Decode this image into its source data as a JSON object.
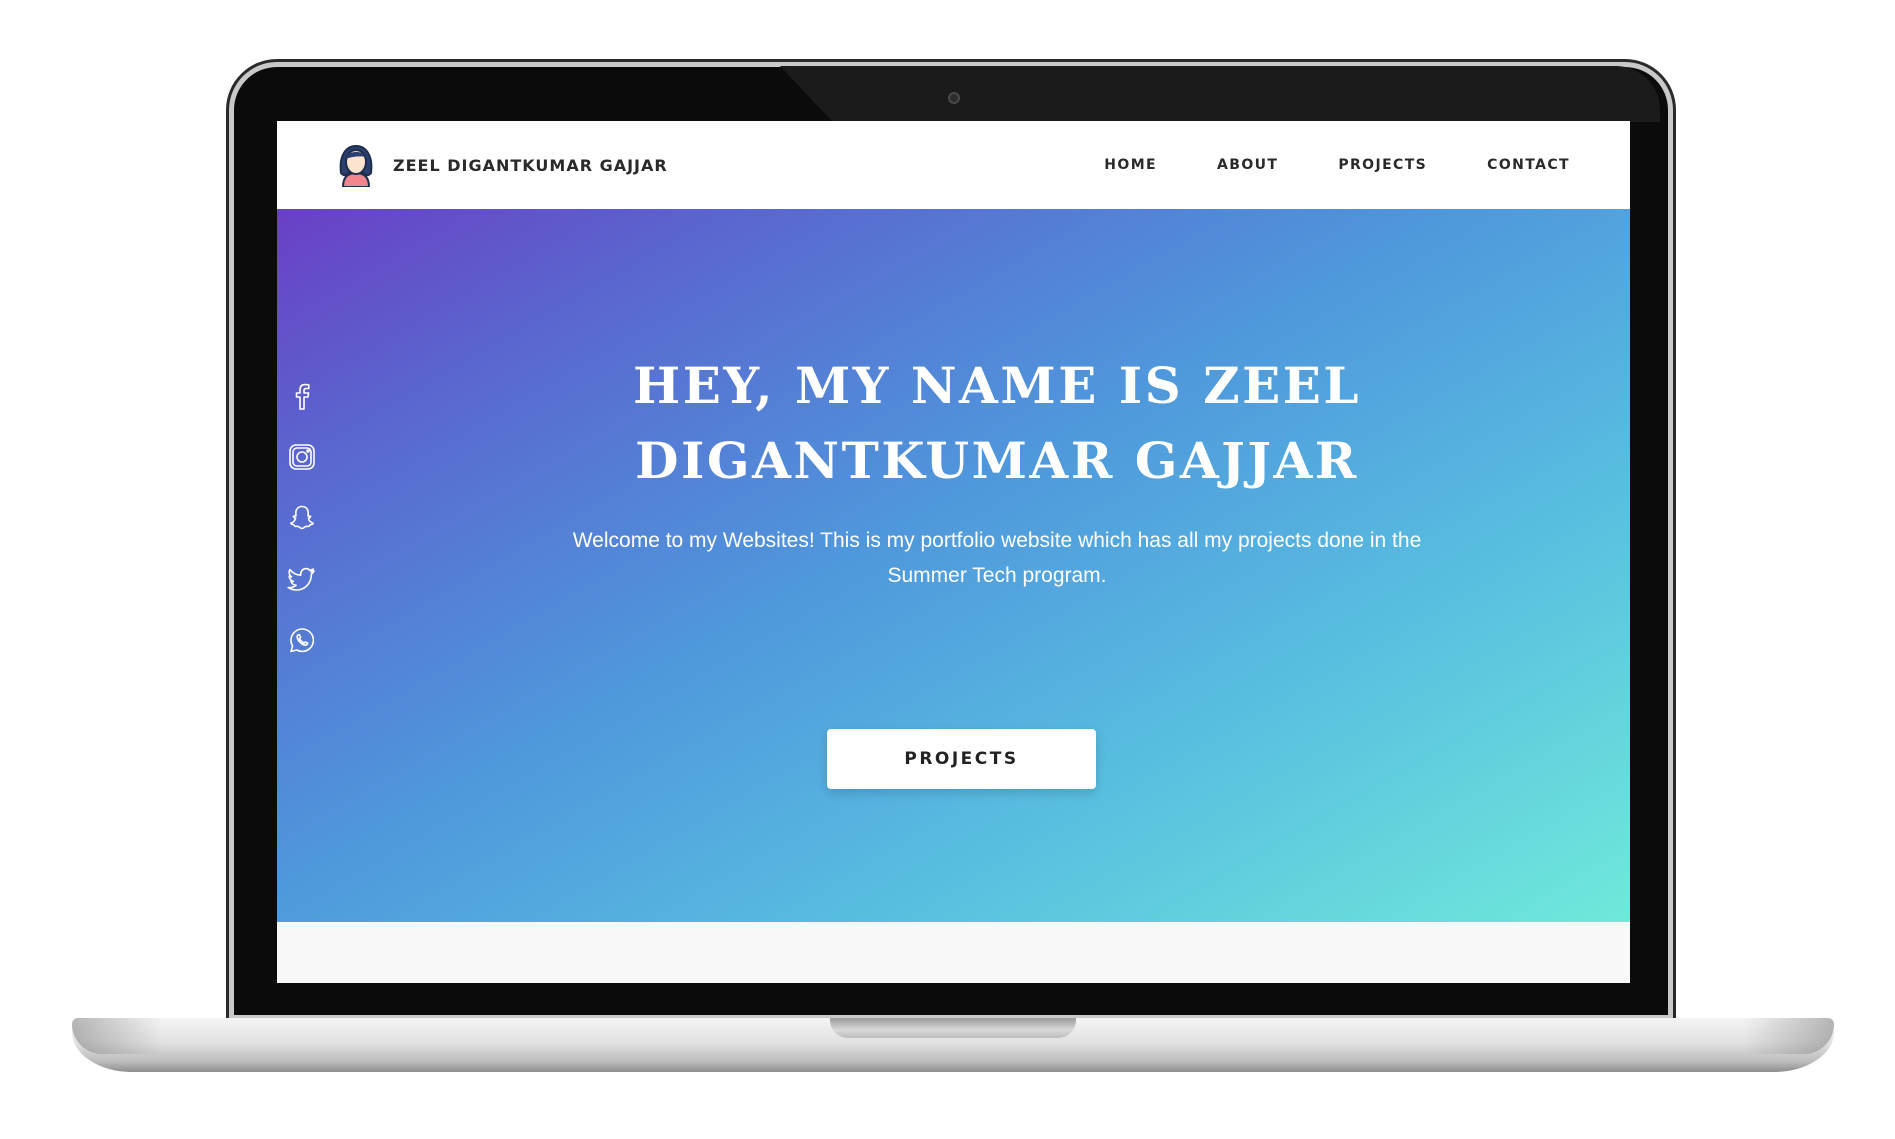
{
  "site": {
    "brand_name": "ZEEL DIGANTKUMAR GAJJAR",
    "avatar_icon": "avatar-icon"
  },
  "nav": {
    "items": [
      {
        "label": "HOME"
      },
      {
        "label": "ABOUT"
      },
      {
        "label": "PROJECTS"
      },
      {
        "label": "CONTACT"
      }
    ]
  },
  "hero": {
    "headline": "HEY, MY NAME IS ZEEL DIGANTKUMAR GAJJAR",
    "tagline": "Welcome to my Websites! This is my portfolio website which has all my projects done in the Summer Tech program.",
    "cta_label": "PROJECTS",
    "gradient_colors": [
      "#6a3fc6",
      "#4f97dc",
      "#6fe9da"
    ]
  },
  "socials": [
    {
      "icon": "facebook-icon"
    },
    {
      "icon": "instagram-icon"
    },
    {
      "icon": "snapchat-icon"
    },
    {
      "icon": "twitter-icon"
    },
    {
      "icon": "whatsapp-icon"
    }
  ]
}
